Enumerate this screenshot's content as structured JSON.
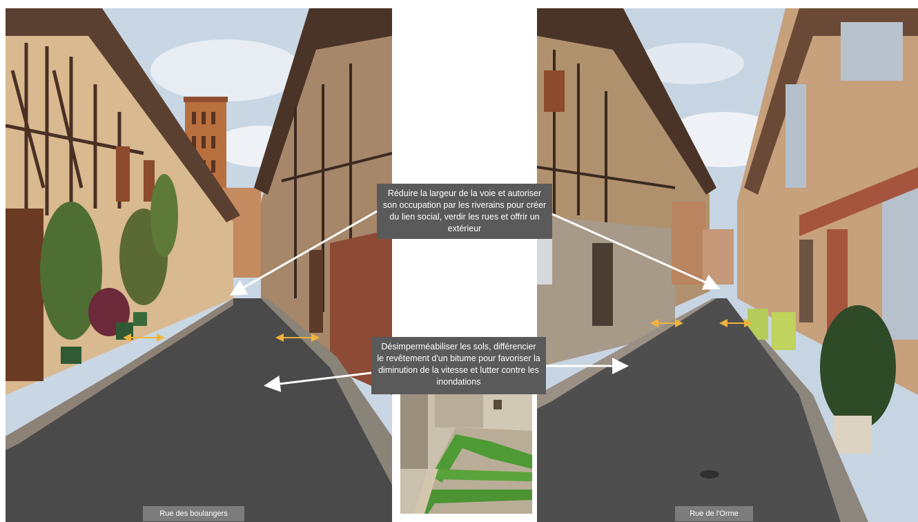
{
  "callouts": {
    "top": "Réduire la largeur de la voie et autoriser son occupation par les riverains pour créer du lien social, verdir les rues et offrir un extérieur",
    "bottom": "Désimperméabiliser les sols, différencier le revêtement d'un bitume pour favoriser la diminution de la vitesse et lutter contre les inondations"
  },
  "captions": {
    "left": "Rue des boulangers",
    "right": "Rue de l'Orme"
  },
  "photos": {
    "left": "half-timbered street with brick bell tower",
    "right": "narrow street with shutters and green chairs",
    "inset": "courtyard with grass strips and paved paths"
  },
  "colors": {
    "callout_bg": "#5a5a5a",
    "caption_bg": "#7c7c7c",
    "arrow_white": "#ffffff",
    "arrow_yellow": "#f0b43c"
  }
}
